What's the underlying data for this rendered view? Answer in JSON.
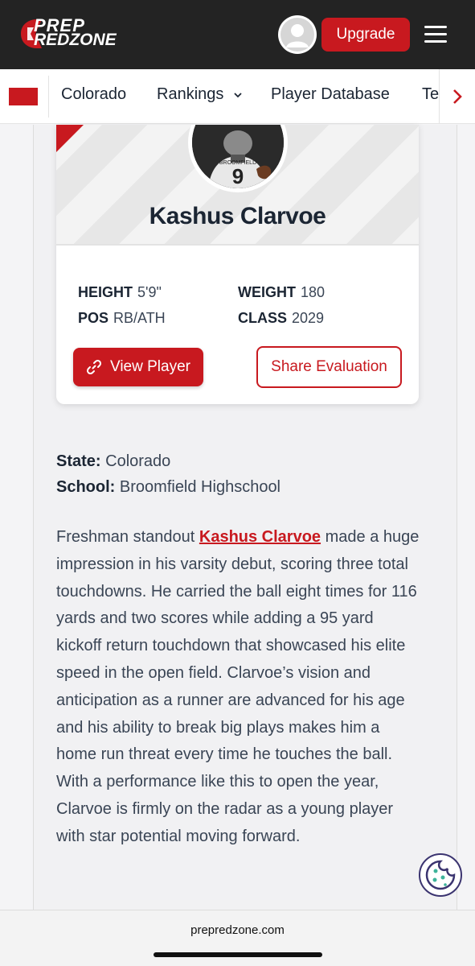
{
  "header": {
    "logo_line1": "PREP",
    "logo_line2": "REDZONE",
    "upgrade_label": "Upgrade"
  },
  "nav": {
    "items": [
      {
        "label": "Colorado"
      },
      {
        "label": "Rankings"
      },
      {
        "label": "Player Database"
      },
      {
        "label": "Te"
      }
    ]
  },
  "player": {
    "name": "Kashus Clarvoe",
    "height_label": "HEIGHT",
    "height": "5'9\"",
    "weight_label": "WEIGHT",
    "weight": "180",
    "pos_label": "POS",
    "pos": "RB/ATH",
    "class_label": "CLASS",
    "class": "2029",
    "jersey": "9",
    "jersey_text": "BROOMFIELD",
    "view_label": "View Player",
    "share_label": "Share Evaluation"
  },
  "details": {
    "state_label": "State:",
    "state": "Colorado",
    "school_label": "School:",
    "school": "Broomfield Highschool"
  },
  "article": {
    "before_link": "Freshman standout ",
    "link": "Kashus Clarvoe",
    "after_link": " made a huge impression in his varsity debut, scoring three total touchdowns. He carried the ball eight times for 116 yards and two scores while adding a 95 yard kickoff return touchdown that showcased his elite speed in the open field. Clarvoe’s vision and anticipation as a runner are advanced for his age and his ability to break big plays makes him a home run threat every time he touches the ball. With a performance like this to open the year, Clarvoe is firmly on the radar as a young player with star potential moving forward."
  },
  "footer": {
    "url": "prepredzone.com"
  },
  "colors": {
    "brand_red": "#c8191f",
    "dark": "#232323"
  },
  "icons": [
    "logo-icon",
    "user-avatar-icon",
    "menu-icon",
    "state-flag-icon",
    "chevron-down-icon",
    "chevron-right-icon",
    "link-icon",
    "cookie-icon"
  ]
}
